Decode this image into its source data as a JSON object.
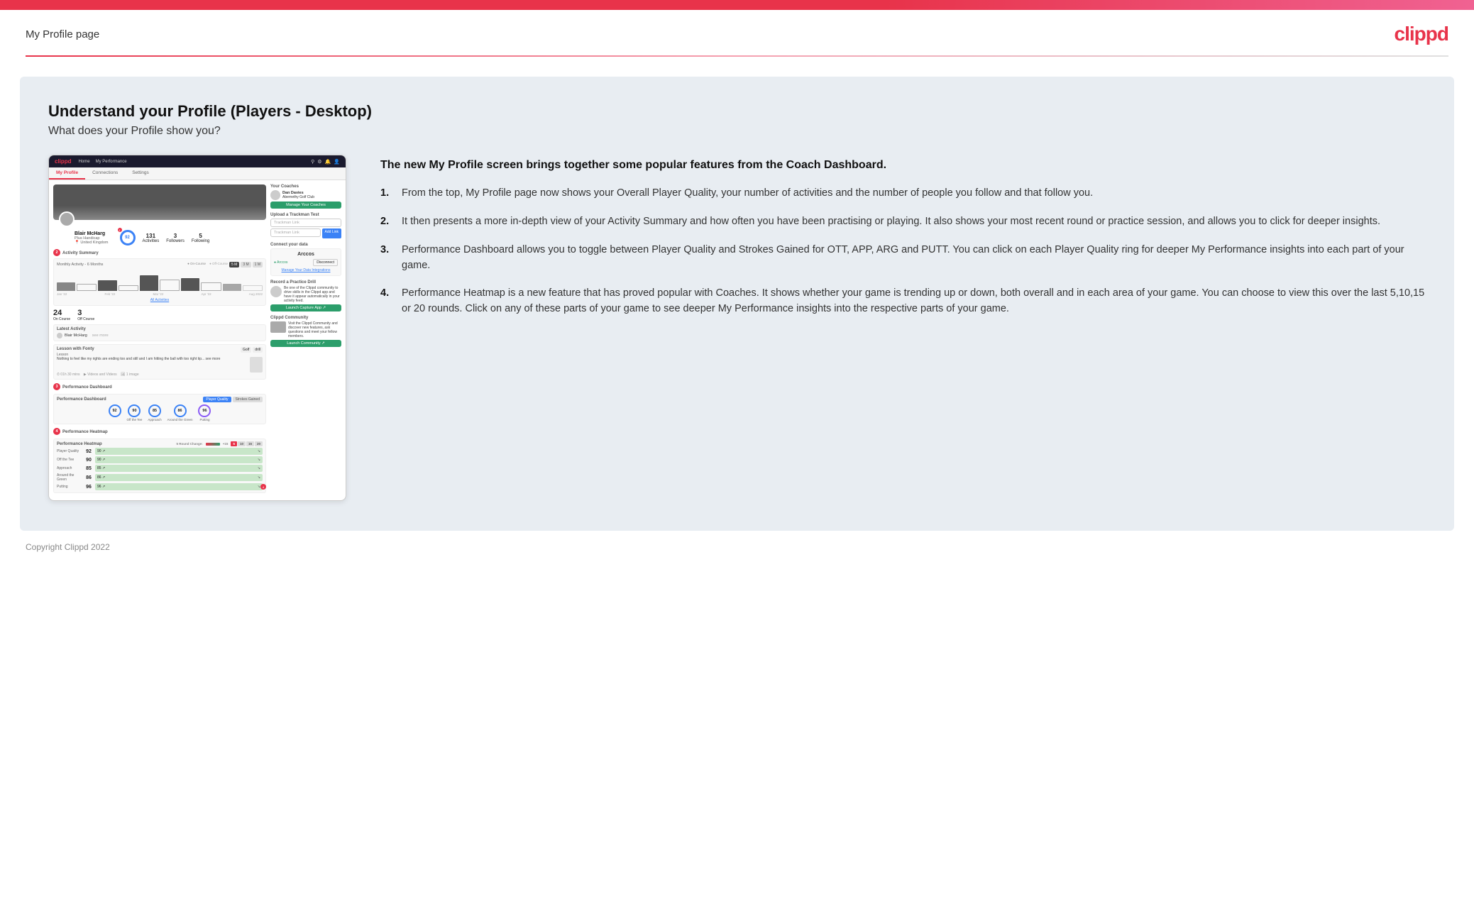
{
  "topbar": {},
  "header": {
    "title": "My Profile page",
    "logo": "clippd"
  },
  "main": {
    "section_title": "Understand your Profile (Players - Desktop)",
    "section_subtitle": "What does your Profile show you?",
    "description_intro": "The new My Profile screen brings together some popular features from the Coach Dashboard.",
    "list_items": [
      {
        "num": "1.",
        "text": "From the top, My Profile page now shows your Overall Player Quality, your number of activities and the number of people you follow and that follow you."
      },
      {
        "num": "2.",
        "text": "It then presents a more in-depth view of your Activity Summary and how often you have been practising or playing. It also shows your most recent round or practice session, and allows you to click for deeper insights."
      },
      {
        "num": "3.",
        "text": "Performance Dashboard allows you to toggle between Player Quality and Strokes Gained for OTT, APP, ARG and PUTT. You can click on each Player Quality ring for deeper My Performance insights into each part of your game."
      },
      {
        "num": "4.",
        "text": "Performance Heatmap is a new feature that has proved popular with Coaches. It shows whether your game is trending up or down, both overall and in each area of your game. You can choose to view this over the last 5,10,15 or 20 rounds. Click on any of these parts of your game to see deeper My Performance insights into the respective parts of your game."
      }
    ],
    "mock": {
      "nav_logo": "clippd",
      "nav_links": [
        "Home",
        "My Performance"
      ],
      "tabs": [
        "My Profile",
        "Connections",
        "Settings"
      ],
      "profile_name": "Blair McHarg",
      "profile_handicap": "Plus Handicap",
      "profile_location": "United Kingdom",
      "player_quality": "92",
      "activities": "131",
      "followers": "3",
      "following": "5",
      "section_labels": [
        "Activity Summary",
        "Performance Dashboard",
        "Performance Heatmap"
      ],
      "activity_chart_label": "Monthly Activity - 6 Months",
      "on_course": "24",
      "off_course": "3",
      "latest_activity_title": "Latest Activity",
      "latest_activity_item": "Blair McHarg",
      "lesson_title": "Lesson with Fonty",
      "lesson_instructor": "Lesson",
      "lesson_time": "01h 30 mins",
      "lesson_videos": "1",
      "lesson_images": "1 image",
      "dash_title": "Performance Dashboard",
      "dash_toggle_options": [
        "Player Quality",
        "Strokes Gained"
      ],
      "rings": [
        {
          "value": "92",
          "label": "",
          "color": "#3b82f6"
        },
        {
          "value": "90",
          "label": "Off the Tee",
          "color": "#3b82f6"
        },
        {
          "value": "85",
          "label": "Approach",
          "color": "#3b82f6"
        },
        {
          "value": "86",
          "label": "Around the Green",
          "color": "#3b82f6"
        },
        {
          "value": "96",
          "label": "Putting",
          "color": "#8b5cf6"
        }
      ],
      "heatmap_title": "Performance Heatmap",
      "heatmap_controls": [
        "5",
        "10",
        "15",
        "20"
      ],
      "heatmap_rows": [
        {
          "label": "Player Quality",
          "value": "92",
          "color": "#e5f5e5"
        },
        {
          "label": "Off the Tee",
          "value": "90",
          "color": "#e5f5e5"
        },
        {
          "label": "Approach",
          "value": "85",
          "color": "#e5f5e5"
        },
        {
          "label": "Around the Green",
          "value": "86",
          "color": "#e5f5e5"
        },
        {
          "label": "Putting",
          "value": "96",
          "color": "#e5f5e5"
        }
      ],
      "coaches_title": "Your Coaches",
      "coach_name": "Dan Davies",
      "coach_club": "Abernethy Golf Club",
      "manage_coaches_btn": "Manage Your Coaches",
      "trackman_title": "Upload a Trackman Test",
      "trackman_placeholder": "Trackman Link",
      "connect_title": "Connect your data",
      "connect_platform": "Arccos",
      "drill_title": "Record a Practice Drill",
      "community_title": "Clippd Community",
      "community_text": "Visit the Clippd Community and discover new features, ask questions and meet your fellow members.",
      "community_btn": "Launch Community"
    }
  },
  "footer": {
    "copyright": "Copyright Clippd 2022"
  }
}
